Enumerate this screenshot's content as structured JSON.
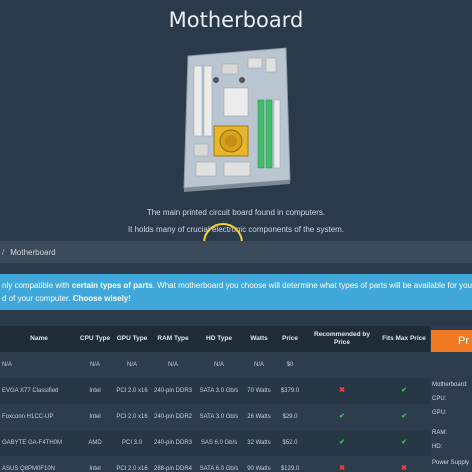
{
  "page": {
    "title": "Motherboard",
    "description_line1": "The main printed circuit board found in computers.",
    "description_line2": "It holds many of crucial electronic components of the system."
  },
  "breadcrumb": {
    "separator": "/",
    "current": "Motherboard"
  },
  "info": {
    "line1_prefix": "nly compatible with ",
    "line1_bold": "certain types of parts",
    "line1_suffix": ". What motherboard you choose will determine what types of parts will be available for you",
    "line2_prefix": "d of your computer. ",
    "line2_bold": "Choose wisely!"
  },
  "table": {
    "headers": [
      "Name",
      "CPU Type",
      "GPU Type",
      "RAM Type",
      "HD Type",
      "Watts",
      "Price",
      "Recommended by Price",
      "Fits Max Price"
    ],
    "rows": [
      {
        "name": "N/A",
        "cpu": "N/A",
        "gpu": "N/A",
        "ram": "N/A",
        "hd": "N/A",
        "watts": "N/A",
        "price": "$0",
        "recommended": "",
        "fits": ""
      },
      {
        "name": "EVGA X77 Classified",
        "cpu": "Intel",
        "gpu": "PCI 2.0 x16",
        "ram": "240-pin DDR3",
        "hd": "SATA 3.0 Gb/s",
        "watts": "70 Watts",
        "price": "$379.0",
        "recommended": "x",
        "fits": "check"
      },
      {
        "name": "Foxconn H1CC-UP",
        "cpu": "Intel",
        "gpu": "PCI 2.0 x16",
        "ram": "240-pin DDR2",
        "hd": "SATA 3.0 Gb/s",
        "watts": "26 Watts",
        "price": "$29.0",
        "recommended": "check",
        "fits": "check"
      },
      {
        "name": "GABYTE GA-F4TH0M",
        "cpu": "AMD",
        "gpu": "PCI 3.0",
        "ram": "240-pin DDR3",
        "hd": "SAS 6.0 Gb/s",
        "watts": "32 Watts",
        "price": "$52.0",
        "recommended": "check",
        "fits": "check"
      },
      {
        "name": "ASUS Q8PM0F10N",
        "cpu": "Intel",
        "gpu": "PCI 2.0 x16",
        "ram": "288-pin DDR4",
        "hd": "SATA 6.0 Gb/s",
        "watts": "90 Watts",
        "price": "$129.0",
        "recommended": "x",
        "fits": "x"
      }
    ]
  },
  "side_panel": {
    "button_label": "Pr",
    "labels": [
      "Motherboard:",
      "CPU:",
      "GPU:",
      "RAM:",
      "HD:",
      "Power Supply"
    ]
  },
  "colors": {
    "background": "#2a3a4a",
    "info_bar": "#3fa7d9",
    "accent_button": "#f07a21",
    "cursor_ring": "#f2d230",
    "mark_x": "#e8463e",
    "mark_check": "#3bbf5a"
  },
  "icons": {
    "hero": "motherboard-illustration",
    "recommended_no": "x-mark-icon",
    "recommended_yes": "check-mark-icon"
  }
}
